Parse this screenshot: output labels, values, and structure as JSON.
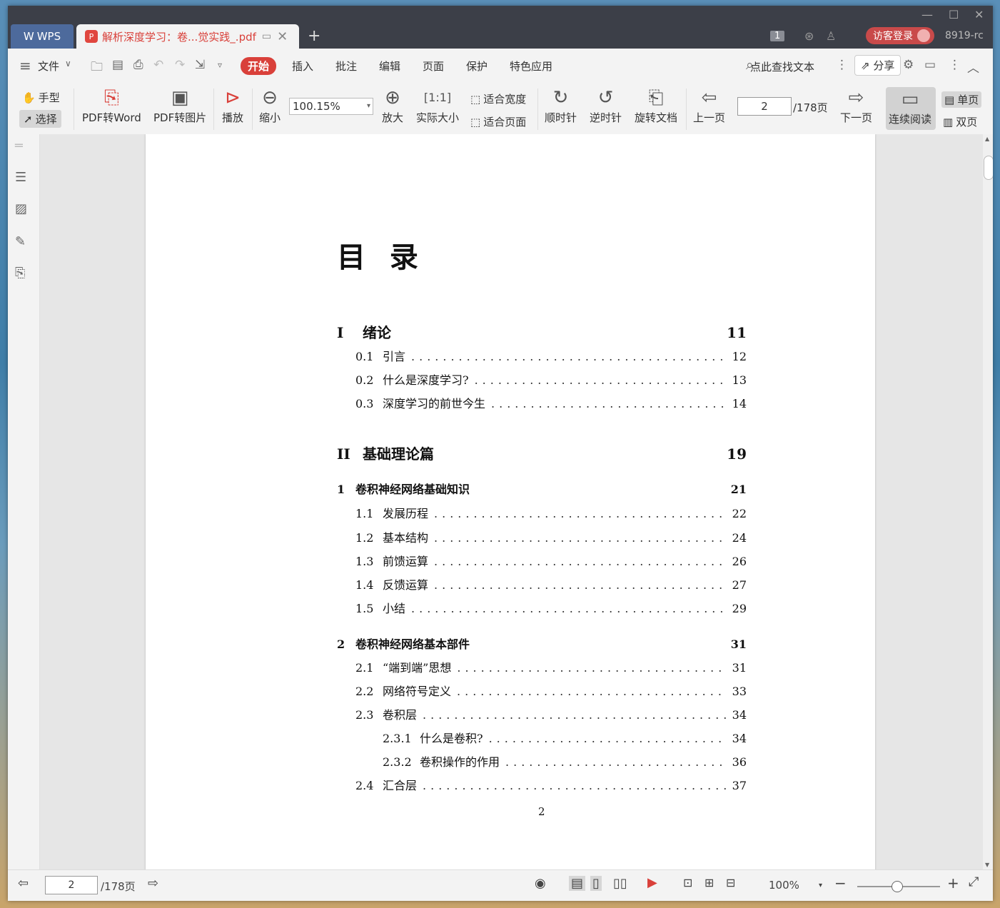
{
  "titlebar": {
    "wps_label": "WPS",
    "doc_tab": "解析深度学习：卷...觉实践_.pdf",
    "badge": "1",
    "login": "访客登录",
    "user": "8919-rc"
  },
  "menubar": {
    "file": "文件",
    "start": "开始",
    "tabs": [
      "插入",
      "批注",
      "编辑",
      "页面",
      "保护",
      "特色应用"
    ],
    "search": "点此查找文本",
    "share": "分享"
  },
  "ribbon": {
    "hand": "手型",
    "select": "选择",
    "to_word": "PDF转Word",
    "to_image": "PDF转图片",
    "play": "播放",
    "zoom_out": "缩小",
    "zoom_value": "100.15%",
    "zoom_in": "放大",
    "actual_size": "实际大小",
    "fit_width": "适合宽度",
    "fit_page": "适合页面",
    "clockwise": "顺时针",
    "counter": "逆时针",
    "rotate_doc": "旋转文档",
    "prev": "上一页",
    "page": "2",
    "total": "/178页",
    "next": "下一页",
    "continuous": "连续阅读",
    "single": "单页",
    "double": "双页"
  },
  "document": {
    "title": "目 录",
    "page_number": "2",
    "entries": [
      {
        "num": "I",
        "label": "绪论",
        "page": "11",
        "kind": "part"
      },
      {
        "num": "0.1",
        "label": "引言",
        "page": "12",
        "kind": "sec"
      },
      {
        "num": "0.2",
        "label": "什么是深度学习?",
        "page": "13",
        "kind": "sec"
      },
      {
        "num": "0.3",
        "label": "深度学习的前世今生",
        "page": "14",
        "kind": "sec"
      },
      {
        "num": "II",
        "label": "基础理论篇",
        "page": "19",
        "kind": "part"
      },
      {
        "num": "1",
        "label": "卷积神经网络基础知识",
        "page": "21",
        "kind": "chap"
      },
      {
        "num": "1.1",
        "label": "发展历程",
        "page": "22",
        "kind": "sec"
      },
      {
        "num": "1.2",
        "label": "基本结构",
        "page": "24",
        "kind": "sec"
      },
      {
        "num": "1.3",
        "label": "前馈运算",
        "page": "26",
        "kind": "sec"
      },
      {
        "num": "1.4",
        "label": "反馈运算",
        "page": "27",
        "kind": "sec"
      },
      {
        "num": "1.5",
        "label": "小结",
        "page": "29",
        "kind": "sec"
      },
      {
        "num": "2",
        "label": "卷积神经网络基本部件",
        "page": "31",
        "kind": "chap"
      },
      {
        "num": "2.1",
        "label": "“端到端”思想",
        "page": "31",
        "kind": "sec"
      },
      {
        "num": "2.2",
        "label": "网络符号定义",
        "page": "33",
        "kind": "sec"
      },
      {
        "num": "2.3",
        "label": "卷积层",
        "page": "34",
        "kind": "sec"
      },
      {
        "num": "2.3.1",
        "label": "什么是卷积?",
        "page": "34",
        "kind": "sub"
      },
      {
        "num": "2.3.2",
        "label": "卷积操作的作用",
        "page": "36",
        "kind": "sub"
      },
      {
        "num": "2.4",
        "label": "汇合层",
        "page": "37",
        "kind": "sec"
      }
    ]
  },
  "statusbar": {
    "page": "2",
    "total": "/178页",
    "zoom": "100%"
  }
}
